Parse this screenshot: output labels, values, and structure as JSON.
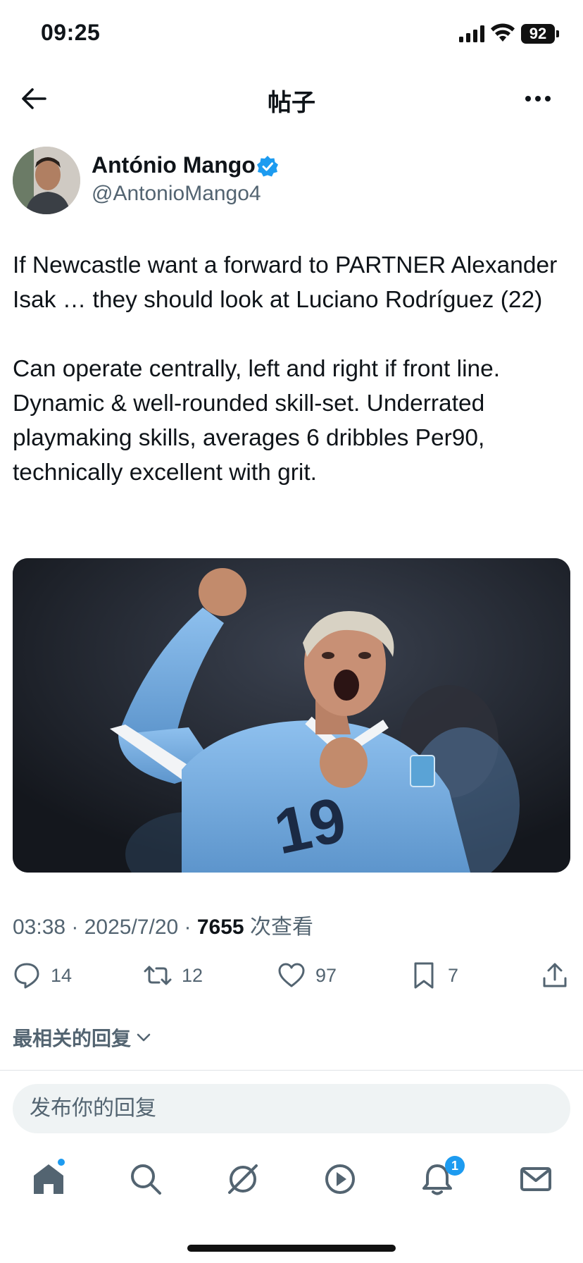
{
  "status_bar": {
    "time": "09:25",
    "battery": "92"
  },
  "header": {
    "title": "帖子"
  },
  "author": {
    "name": "António Mango",
    "handle": "@AntonioMango4",
    "verified": true
  },
  "tweet": {
    "paragraph_1": "If Newcastle want a forward to PARTNER Alexander Isak … they should look at Luciano Rodríguez (22)",
    "paragraph_2": "Can operate centrally, left and right if front line. Dynamic & well-rounded skill-set. Underrated playmaking skills, averages 6 dribbles Per90, technically excellent with grit."
  },
  "meta": {
    "time_date": "03:38 · 2025/7/20 · ",
    "views": "7655",
    "views_suffix": " 次查看"
  },
  "actions": {
    "replies": "14",
    "reposts": "12",
    "likes": "97",
    "bookmarks": "7"
  },
  "replies_sort": {
    "label": "最相关的回复"
  },
  "reply_input": {
    "placeholder": "发布你的回复"
  },
  "bottom_nav": {
    "items": [
      "home-icon",
      "search-icon",
      "grok-icon",
      "video-icon",
      "notifications-icon",
      "messages-icon"
    ],
    "notification_badge": "1"
  },
  "colors": {
    "accent": "#1d9bf0",
    "text": "#0f1419",
    "secondary": "#536471",
    "jersey": "#7fb4e6"
  }
}
